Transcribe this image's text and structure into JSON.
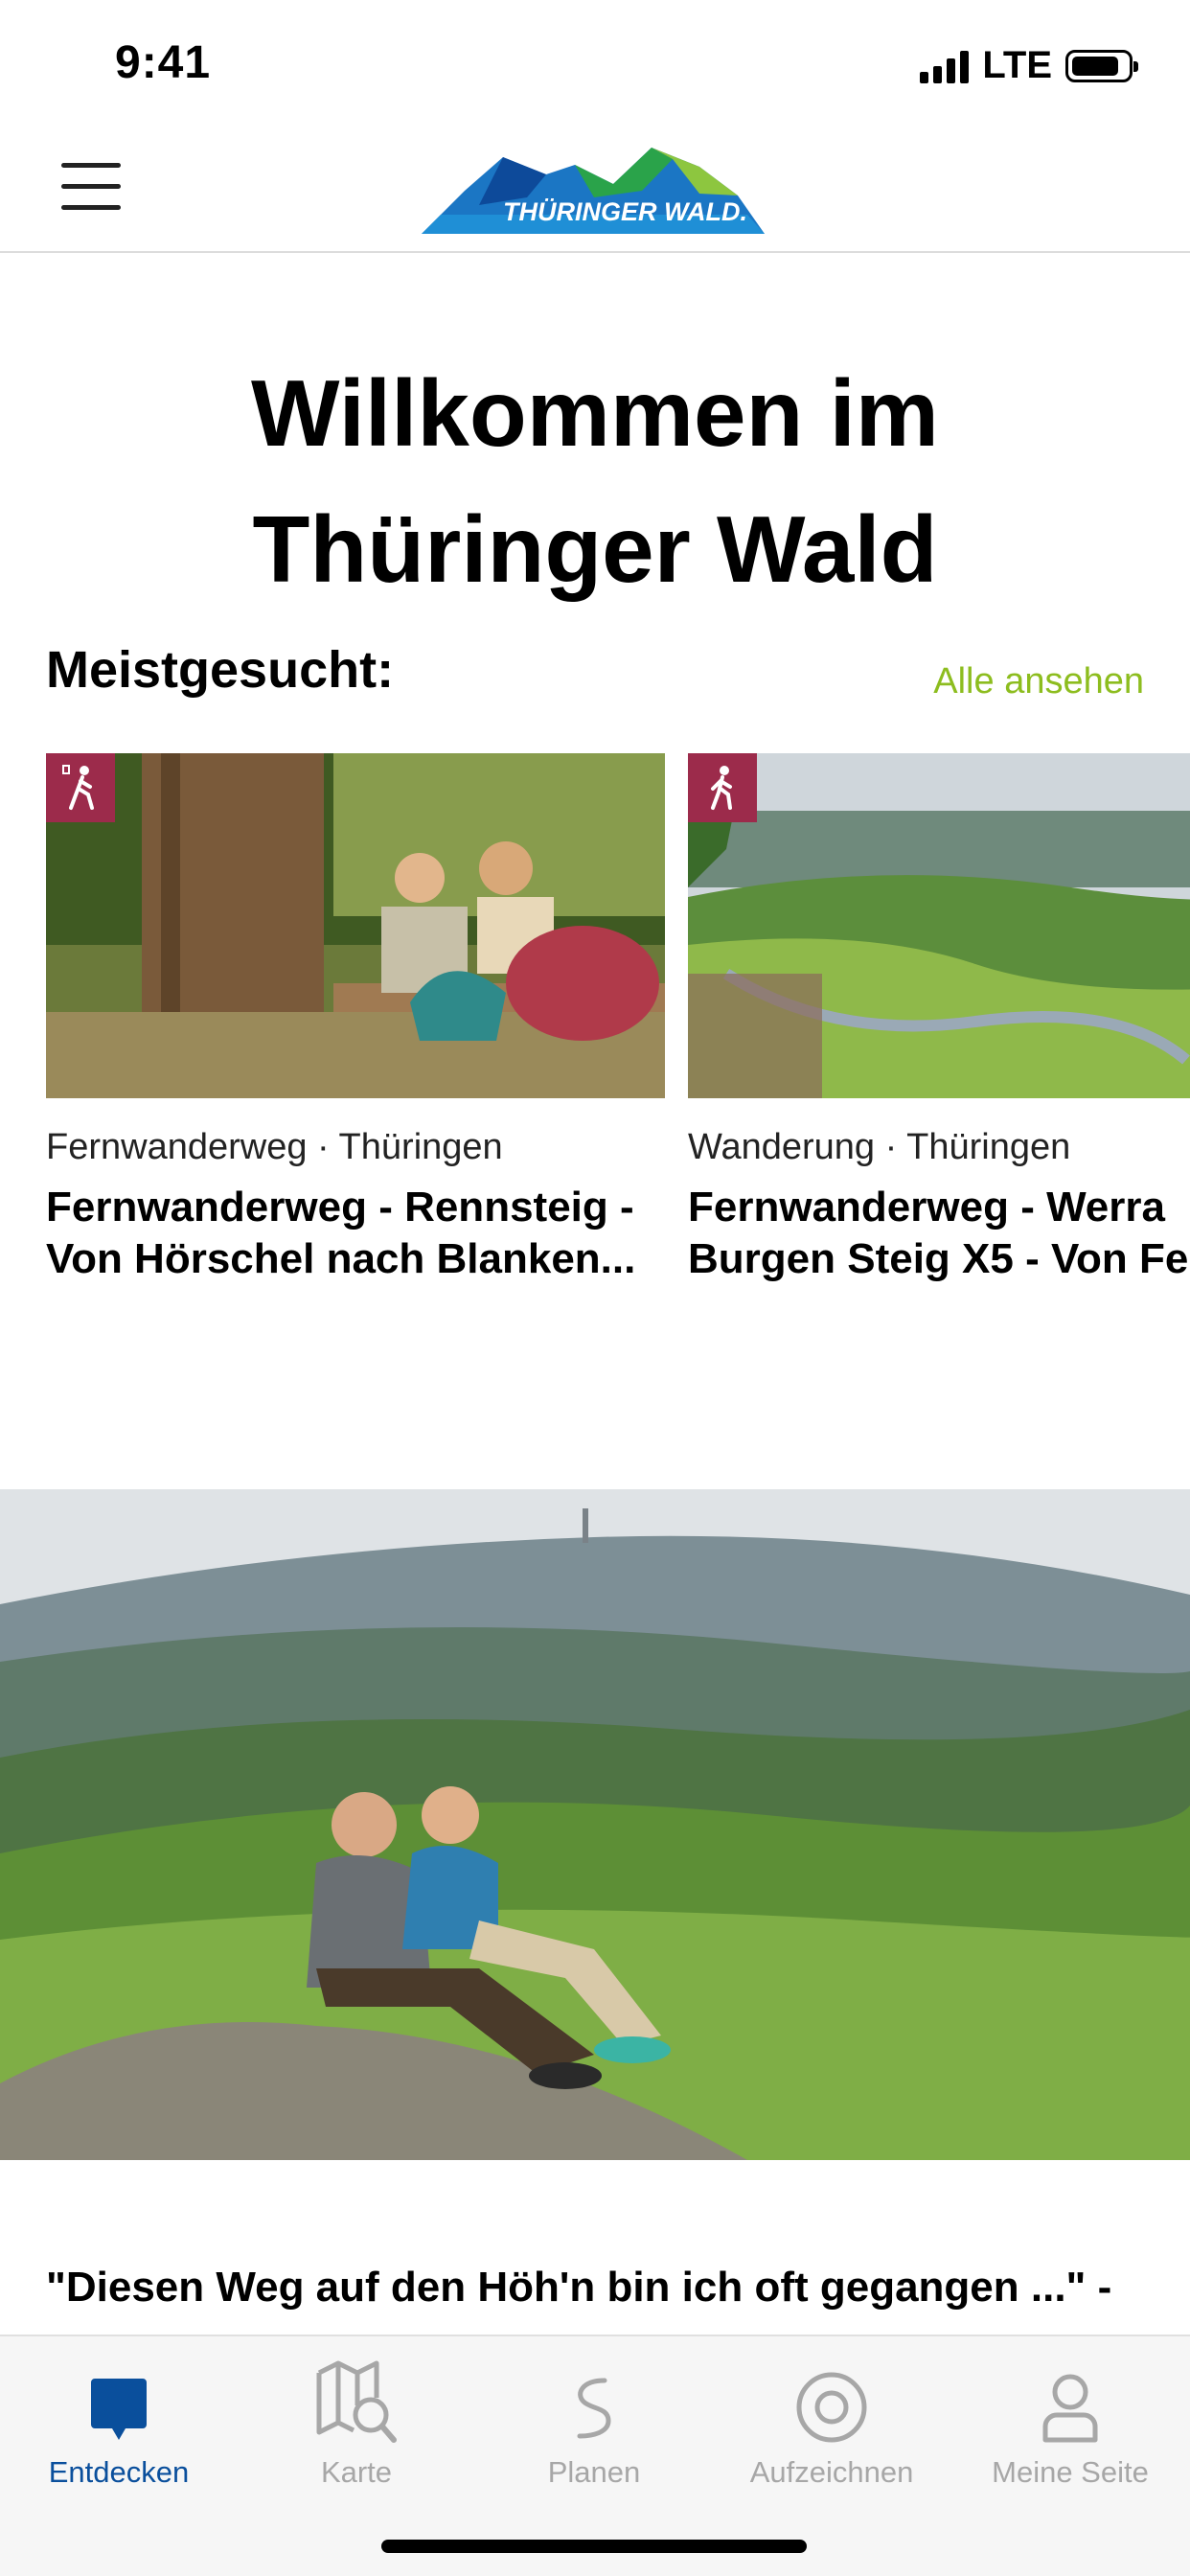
{
  "status_bar": {
    "time": "9:41",
    "network": "LTE"
  },
  "header": {
    "logo_text": "THÜRINGER WALD."
  },
  "hero": {
    "title_line1": "Willkommen im",
    "title_line2": "Thüringer Wald"
  },
  "most_searched": {
    "heading": "Meistgesucht:",
    "see_all": "Alle ansehen",
    "items": [
      {
        "category": "Fernwanderweg · Thüringen",
        "title_line1": "Fernwanderweg - Rennsteig -",
        "title_line2": "Von Hörschel nach Blanken...",
        "icon": "hiker-icon"
      },
      {
        "category": "Wanderung · Thüringen",
        "title_line1": "Fernwanderweg - Werra",
        "title_line2": "Burgen Steig X5 - Von Fe",
        "icon": "walker-icon"
      }
    ]
  },
  "feature": {
    "quote": "\"Diesen Weg auf den Höh'n bin ich oft gegangen ...\" -"
  },
  "tabbar": {
    "tabs": [
      {
        "label": "Entdecken",
        "icon": "discover-icon",
        "active": true
      },
      {
        "label": "Karte",
        "icon": "map-search-icon",
        "active": false
      },
      {
        "label": "Planen",
        "icon": "route-icon",
        "active": false
      },
      {
        "label": "Aufzeichnen",
        "icon": "record-icon",
        "active": false
      },
      {
        "label": "Meine Seite",
        "icon": "profile-icon",
        "active": false
      }
    ]
  },
  "colors": {
    "accent_green": "#8dbd1f",
    "badge_red": "#9c2b4b",
    "tab_active_blue": "#0a4f9c",
    "tab_inactive": "#a7a7a7"
  }
}
